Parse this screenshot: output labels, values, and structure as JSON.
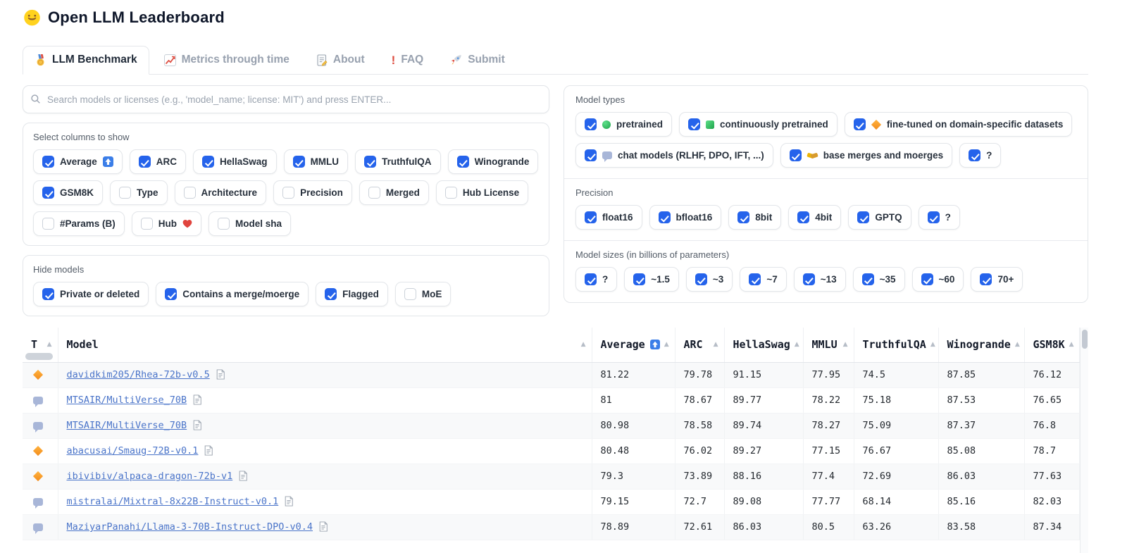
{
  "colors": {
    "checkbox-blue": "#2563eb",
    "link-blue": "#4a74c9",
    "stripe": "#f8f9fa"
  },
  "header": {
    "title": "Open LLM Leaderboard"
  },
  "tabs": {
    "benchmark": "LLM Benchmark",
    "metrics": "Metrics through time",
    "about": "About",
    "faq": "FAQ",
    "submit": "Submit"
  },
  "search": {
    "placeholder": "Search models or licenses (e.g., 'model_name; license: MIT') and press ENTER..."
  },
  "columns": {
    "label": "Select columns to show",
    "options": [
      {
        "label": "Average",
        "state": "checked"
      },
      {
        "label": "ARC",
        "state": "checked"
      },
      {
        "label": "HellaSwag",
        "state": "checked"
      },
      {
        "label": "MMLU",
        "state": "checked"
      },
      {
        "label": "TruthfulQA",
        "state": "checked"
      },
      {
        "label": "Winogrande",
        "state": "checked"
      },
      {
        "label": "GSM8K",
        "state": "checked"
      },
      {
        "label": "Type",
        "state": "unchecked"
      },
      {
        "label": "Architecture",
        "state": "unchecked"
      },
      {
        "label": "Precision",
        "state": "unchecked"
      },
      {
        "label": "Merged",
        "state": "unchecked"
      },
      {
        "label": "Hub License",
        "state": "unchecked"
      },
      {
        "label": "#Params (B)",
        "state": "unchecked"
      },
      {
        "label": "Hub",
        "state": "unchecked"
      },
      {
        "label": "Model sha",
        "state": "unchecked"
      }
    ]
  },
  "hide": {
    "label": "Hide models",
    "options": [
      {
        "label": "Private or deleted",
        "state": "checked"
      },
      {
        "label": "Contains a merge/moerge",
        "state": "checked"
      },
      {
        "label": "Flagged",
        "state": "checked"
      },
      {
        "label": "MoE",
        "state": "unchecked"
      }
    ]
  },
  "model_types": {
    "label": "Model types",
    "options": [
      {
        "label": "pretrained",
        "state": "checked"
      },
      {
        "label": "continuously pretrained",
        "state": "checked"
      },
      {
        "label": "fine-tuned on domain-specific datasets",
        "state": "checked"
      },
      {
        "label": "chat models (RLHF, DPO, IFT, ...)",
        "state": "checked"
      },
      {
        "label": "base merges and moerges",
        "state": "checked"
      },
      {
        "label": "?",
        "state": "checked"
      }
    ]
  },
  "precision": {
    "label": "Precision",
    "options": [
      {
        "label": "float16",
        "state": "checked"
      },
      {
        "label": "bfloat16",
        "state": "checked"
      },
      {
        "label": "8bit",
        "state": "checked"
      },
      {
        "label": "4bit",
        "state": "checked"
      },
      {
        "label": "GPTQ",
        "state": "checked"
      },
      {
        "label": "?",
        "state": "checked"
      }
    ]
  },
  "sizes": {
    "label": "Model sizes (in billions of parameters)",
    "options": [
      {
        "label": "?",
        "state": "checked"
      },
      {
        "label": "~1.5",
        "state": "checked"
      },
      {
        "label": "~3",
        "state": "checked"
      },
      {
        "label": "~7",
        "state": "checked"
      },
      {
        "label": "~13",
        "state": "checked"
      },
      {
        "label": "~35",
        "state": "checked"
      },
      {
        "label": "~60",
        "state": "checked"
      },
      {
        "label": "70+",
        "state": "checked"
      }
    ]
  },
  "table": {
    "headers": {
      "t": "T",
      "model": "Model",
      "average": "Average",
      "arc": "ARC",
      "hellaswag": "HellaSwag",
      "mmlu": "MMLU",
      "truthfulqa": "TruthfulQA",
      "winogrande": "Winogrande",
      "gsm8k": "GSM8K"
    },
    "rows": [
      {
        "type_icon": "icon-orange-diamond",
        "model": "davidkim205/Rhea-72b-v0.5",
        "average": "81.22",
        "arc": "79.78",
        "hellaswag": "91.15",
        "mmlu": "77.95",
        "truthfulqa": "74.5",
        "winogrande": "87.85",
        "gsm8k": "76.12"
      },
      {
        "type_icon": "icon-chat",
        "model": "MTSAIR/MultiVerse_70B",
        "average": "81",
        "arc": "78.67",
        "hellaswag": "89.77",
        "mmlu": "78.22",
        "truthfulqa": "75.18",
        "winogrande": "87.53",
        "gsm8k": "76.65"
      },
      {
        "type_icon": "icon-chat",
        "model": "MTSAIR/MultiVerse_70B",
        "average": "80.98",
        "arc": "78.58",
        "hellaswag": "89.74",
        "mmlu": "78.27",
        "truthfulqa": "75.09",
        "winogrande": "87.37",
        "gsm8k": "76.8"
      },
      {
        "type_icon": "icon-orange-diamond",
        "model": "abacusai/Smaug-72B-v0.1",
        "average": "80.48",
        "arc": "76.02",
        "hellaswag": "89.27",
        "mmlu": "77.15",
        "truthfulqa": "76.67",
        "winogrande": "85.08",
        "gsm8k": "78.7"
      },
      {
        "type_icon": "icon-orange-diamond",
        "model": "ibivibiv/alpaca-dragon-72b-v1",
        "average": "79.3",
        "arc": "73.89",
        "hellaswag": "88.16",
        "mmlu": "77.4",
        "truthfulqa": "72.69",
        "winogrande": "86.03",
        "gsm8k": "77.63"
      },
      {
        "type_icon": "icon-chat",
        "model": "mistralai/Mixtral-8x22B-Instruct-v0.1",
        "average": "79.15",
        "arc": "72.7",
        "hellaswag": "89.08",
        "mmlu": "77.77",
        "truthfulqa": "68.14",
        "winogrande": "85.16",
        "gsm8k": "82.03"
      },
      {
        "type_icon": "icon-chat",
        "model": "MaziyarPanahi/Llama-3-70B-Instruct-DPO-v0.4",
        "average": "78.89",
        "arc": "72.61",
        "hellaswag": "86.03",
        "mmlu": "80.5",
        "truthfulqa": "63.26",
        "winogrande": "83.58",
        "gsm8k": "87.34"
      }
    ]
  }
}
